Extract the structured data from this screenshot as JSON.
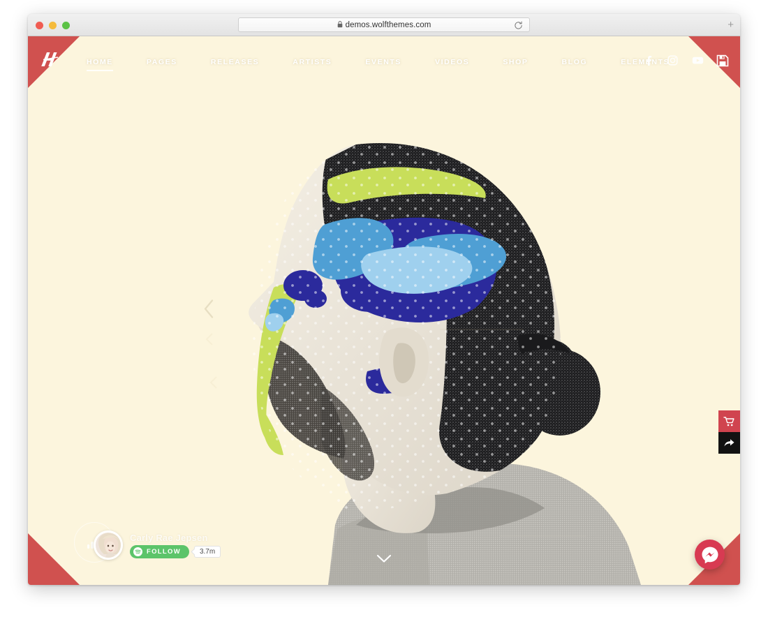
{
  "browser": {
    "url": "demos.wolfthemes.com",
    "lock_icon": "lock-icon",
    "reload_icon": "reload-icon",
    "new_tab_label": "+",
    "traffic_lights": [
      "close",
      "minimize",
      "maximize"
    ]
  },
  "site": {
    "logo_letter": "H",
    "brand_color": "#d0514f",
    "background_color": "#fcf5dd",
    "nav": [
      {
        "label": "HOME",
        "active": true
      },
      {
        "label": "PAGES",
        "active": false
      },
      {
        "label": "RELEASES",
        "active": false
      },
      {
        "label": "ARTISTS",
        "active": false
      },
      {
        "label": "EVENTS",
        "active": false
      },
      {
        "label": "VIDEOS",
        "active": false
      },
      {
        "label": "SHOP",
        "active": false
      },
      {
        "label": "BLOG",
        "active": false
      },
      {
        "label": "ELEMENTS",
        "active": false
      }
    ],
    "socials": [
      {
        "name": "facebook-icon"
      },
      {
        "name": "instagram-icon"
      },
      {
        "name": "youtube-icon"
      }
    ],
    "save_icon": "save-floppy-icon"
  },
  "hero": {
    "slider_prev_icon": "chevron-left-icon",
    "scroll_down_icon": "chevron-down-icon",
    "artwork_colors": {
      "deep_blue": "#2b2a9c",
      "mid_blue": "#4f9fd4",
      "pale_blue": "#9fd0ee",
      "lime": "#c8de5a",
      "cream": "#fcf5dd"
    }
  },
  "artist": {
    "name": "Carly Rae Jepsen",
    "follow_label": "FOLLOW",
    "follow_count": "3.7m",
    "follow_color": "#5cc46a",
    "spotify_icon": "spotify-icon",
    "chart_icon": "chart-bars-icon",
    "avatar_name": "avatar"
  },
  "side_actions": [
    {
      "name": "cart-icon",
      "color": "#d0444f"
    },
    {
      "name": "share-icon",
      "color": "#121212"
    }
  ],
  "messenger": {
    "icon": "messenger-icon",
    "color": "#d83a52"
  }
}
